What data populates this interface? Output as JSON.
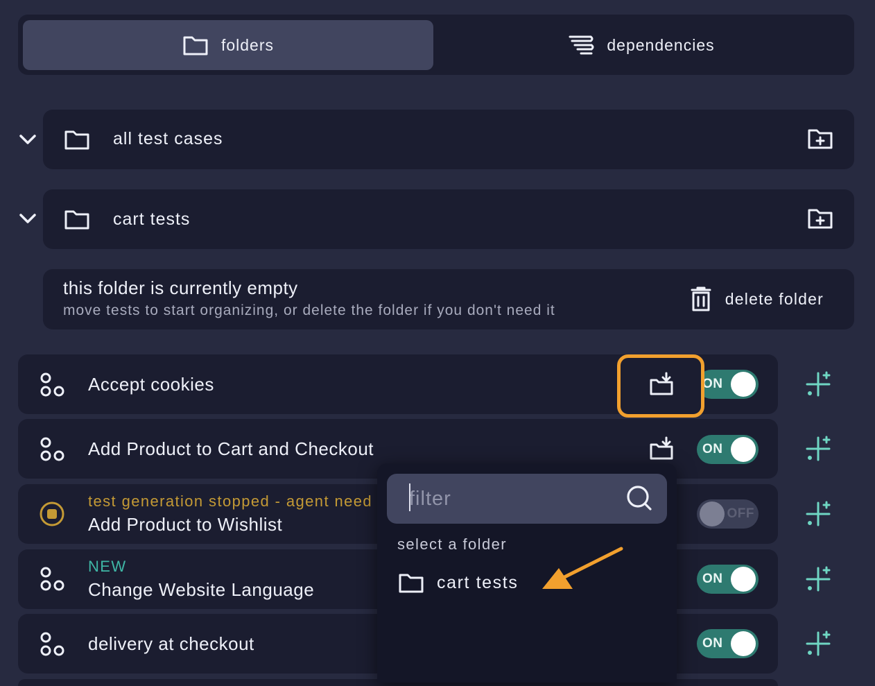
{
  "tabs": [
    {
      "label": "folders",
      "active": true,
      "icon": "folder-icon"
    },
    {
      "label": "dependencies",
      "active": false,
      "icon": "dependencies-icon"
    }
  ],
  "folders": [
    {
      "name": "all test cases",
      "expanded": true
    },
    {
      "name": "cart tests",
      "expanded": true
    }
  ],
  "empty_state": {
    "title": "this folder is currently empty",
    "subtitle": "move tests to start organizing, or delete the folder if you don't need it",
    "delete_label": "delete folder"
  },
  "tests": [
    {
      "title": "Accept cookies",
      "status": "",
      "toggle": "ON",
      "enabled": true,
      "icon": "agent-icon"
    },
    {
      "title": "Add Product to Cart and Checkout",
      "status": "",
      "toggle": "ON",
      "enabled": true,
      "icon": "agent-icon"
    },
    {
      "title": "Add Product to Wishlist",
      "status": "test generation stopped - agent need",
      "toggle": "OFF",
      "enabled": false,
      "icon": "stop-icon"
    },
    {
      "title": "Change Website Language",
      "status": "NEW",
      "toggle": "ON",
      "enabled": true,
      "icon": "agent-icon"
    },
    {
      "title": "delivery at checkout",
      "status": "",
      "toggle": "ON",
      "enabled": true,
      "icon": "agent-icon"
    }
  ],
  "dropdown": {
    "placeholder": "filter",
    "value": "",
    "section_label": "select a folder",
    "items": [
      {
        "label": "cart tests",
        "icon": "folder-icon"
      }
    ]
  },
  "colors": {
    "background": "#272a40",
    "panel": "#1b1d30",
    "active_tab": "#41455f",
    "toggle_on": "#2e7a70",
    "accent_teal": "#3fb7a6",
    "warning_gold": "#c49a35",
    "highlight_orange": "#f2a02e"
  }
}
